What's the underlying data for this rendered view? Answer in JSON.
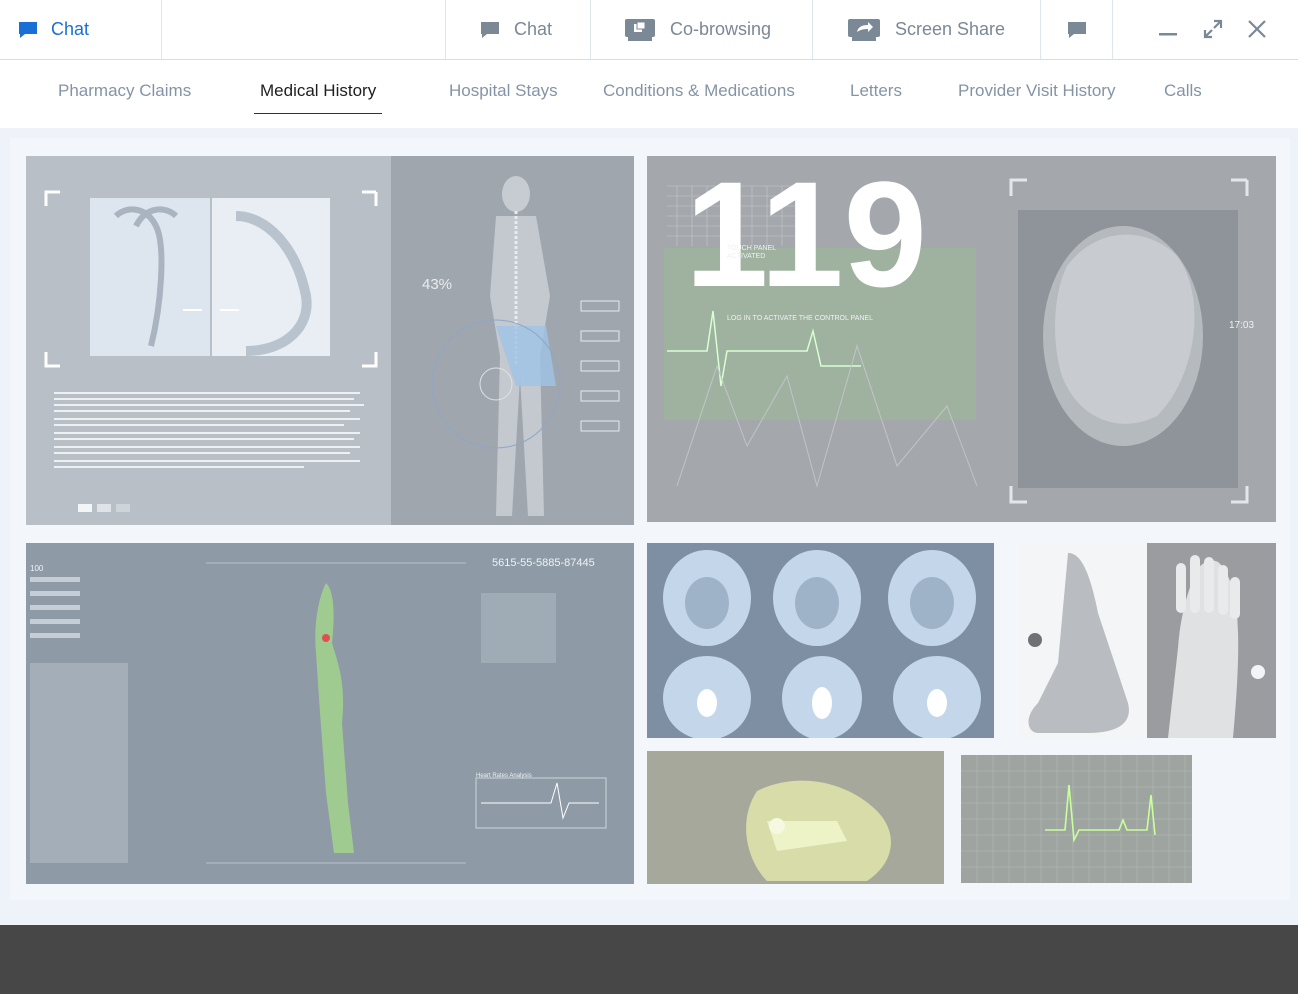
{
  "topbar": {
    "left_label": "Chat",
    "chat_label": "Chat",
    "cobrowse_label": "Co-browsing",
    "screenshare_label": "Screen Share"
  },
  "tabs": [
    {
      "label": "Pharmacy Claims"
    },
    {
      "label": "Medical History"
    },
    {
      "label": "Hospital Stays"
    },
    {
      "label": "Conditions & Medications"
    },
    {
      "label": "Letters"
    },
    {
      "label": "Provider Visit History"
    },
    {
      "label": "Calls"
    }
  ],
  "images": {
    "xray_panel_pct": "43%",
    "heart_panel_number": "119",
    "heart_panel_line1": "TOUCH PANEL",
    "heart_panel_line2": "ACTIVATED",
    "heart_panel_login": "LOG IN TO ACTIVATE THE CONTROL PANEL",
    "heart_panel_time": "17:03",
    "hud_panel_code": "5615-55-5885-87445",
    "hud_panel_label": "Heart Rates Analysis",
    "hud_panel_top": "100"
  },
  "colors": {
    "accent": "#1a6fd6",
    "tab_inactive": "#8494a6",
    "content_bg": "#eef3f9",
    "footer": "#474747"
  }
}
